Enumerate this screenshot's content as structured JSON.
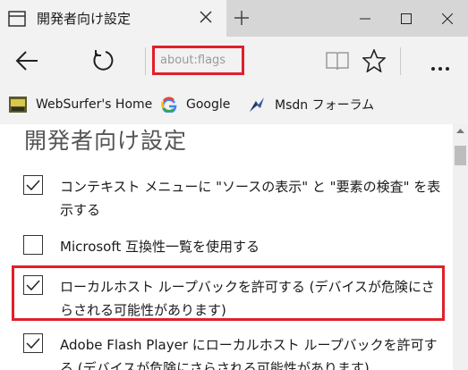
{
  "tab": {
    "title": "開発者向け設定"
  },
  "address": {
    "url": "about:flags"
  },
  "favorites": [
    {
      "label": "WebSurfer's Home",
      "icon": "websurfer-icon"
    },
    {
      "label": "Google",
      "icon": "google-icon"
    },
    {
      "label": "Msdn フォーラム",
      "icon": "msdn-icon"
    }
  ],
  "page": {
    "title": "開発者向け設定",
    "options": [
      {
        "label": "コンテキスト メニューに \"ソースの表示\" と \"要素の検査\" を表示する",
        "checked": true
      },
      {
        "label": "Microsoft 互換性一覧を使用する",
        "checked": false
      },
      {
        "label": "ローカルホスト ループバックを許可する (デバイスが危険にさらされる可能性があります)",
        "checked": true
      },
      {
        "label": "Adobe Flash Player にローカルホスト ループバックを許可する (デバイスが危険にさらされる可能性があります)",
        "checked": true
      }
    ]
  },
  "colors": {
    "highlight": "#e0202a",
    "chrome": "#f2f2f2"
  }
}
